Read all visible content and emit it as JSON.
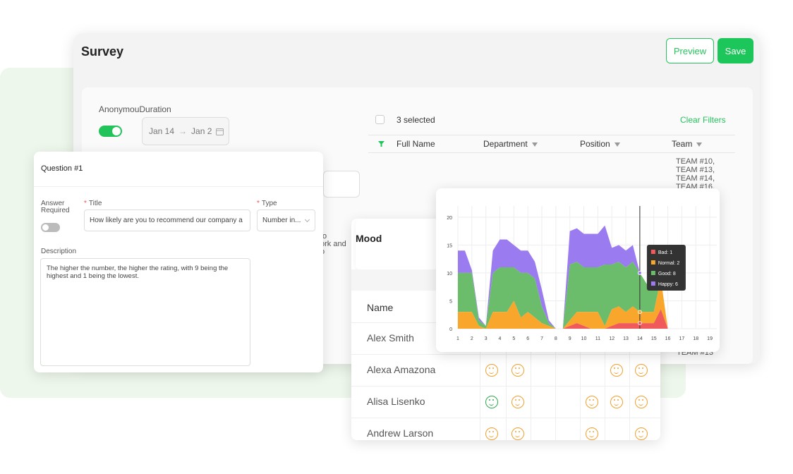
{
  "survey": {
    "title": "Survey",
    "preview_label": "Preview",
    "save_label": "Save",
    "anonymous_label": "AnonymouDuration",
    "date_start": "Jan 14",
    "date_end": "Jan 2",
    "bg_text": [
      "to",
      "ork and",
      "o"
    ]
  },
  "table": {
    "selected_text": "3 selected",
    "clear_filters": "Clear Filters",
    "headers": [
      "Full Name",
      "Department",
      "Position",
      "Team"
    ],
    "team_cells": [
      "TEAM #10,",
      "TEAM #13,",
      "TEAM #14,",
      "TEAM #16,"
    ],
    "team_bottom": "TEAM #13"
  },
  "question": {
    "title": "Question #1",
    "answer_required_label": [
      "Answer",
      "Required"
    ],
    "title_label": "Title",
    "type_label": "Type",
    "title_value": "How likely are you to recommend our company a",
    "type_value": "Number in...",
    "description_label": "Description",
    "description_value": "The higher the number, the higher the rating, with 9 being the highest and 1 being the lowest."
  },
  "mood": {
    "title": "Mood",
    "name_header": "Name",
    "rows": [
      {
        "name": "Alex Smith",
        "faces": []
      },
      {
        "name": "Alexa Amazona",
        "faces": [
          "neutral",
          "neutral",
          "",
          "",
          "",
          "neutral",
          "neutral"
        ]
      },
      {
        "name": "Alisa Lisenko",
        "faces": [
          "happy",
          "neutral",
          "",
          "",
          "neutral",
          "neutral",
          "neutral"
        ]
      },
      {
        "name": "Andrew Larson",
        "faces": [
          "neutral",
          "neutral",
          "",
          "",
          "neutral",
          "",
          "neutral"
        ]
      }
    ]
  },
  "chart_data": {
    "type": "area",
    "stacked": true,
    "x": [
      1,
      1.5,
      2,
      2.5,
      3,
      3.5,
      4,
      4.5,
      5,
      5.5,
      6,
      6.5,
      7,
      7.5,
      8,
      8.5,
      9,
      9.5,
      10,
      10.5,
      11,
      11.5,
      12,
      12.5,
      13,
      13.5,
      14,
      14.5,
      15,
      15.5,
      16,
      16.5,
      17,
      17.5,
      18,
      18.5,
      19,
      19.5
    ],
    "ylim": [
      0,
      22
    ],
    "yticks": [
      0,
      5,
      10,
      15,
      20
    ],
    "xticks": [
      1,
      2,
      3,
      4,
      5,
      6,
      7,
      8,
      9,
      10,
      11,
      12,
      13,
      14,
      15,
      16,
      17,
      18,
      19
    ],
    "series": [
      {
        "name": "Bad",
        "color": "#f05a5a",
        "values": [
          0,
          0,
          0,
          0,
          0,
          0,
          0,
          0,
          0,
          0,
          0,
          0,
          0,
          0,
          0,
          0,
          0.5,
          1,
          0.5,
          0,
          0,
          0,
          0.5,
          1,
          1,
          1,
          1,
          1,
          1,
          3.5,
          0,
          0,
          0,
          0,
          0,
          0,
          0,
          0
        ]
      },
      {
        "name": "Normal",
        "color": "#f8a62c",
        "values": [
          3,
          3,
          3,
          0.5,
          0,
          3,
          3,
          3,
          5,
          2,
          3,
          2,
          1,
          0.5,
          0,
          0,
          1,
          2,
          2.5,
          3,
          3,
          0.5,
          3,
          3,
          2,
          3,
          2,
          2,
          2,
          5.5,
          0,
          0,
          0,
          0,
          0,
          0,
          0,
          0
        ]
      },
      {
        "name": "Good",
        "color": "#6cbd6b",
        "values": [
          7,
          7,
          7,
          1,
          0.5,
          7,
          8,
          8,
          6,
          8,
          7,
          7,
          3,
          0.5,
          0,
          0,
          10,
          9,
          8,
          8,
          8,
          11,
          8,
          8,
          8,
          8,
          7,
          5,
          5,
          0,
          0,
          0,
          0,
          0,
          0,
          0,
          0,
          0
        ]
      },
      {
        "name": "Happy",
        "color": "#9b7bf0",
        "values": [
          4,
          4,
          0.5,
          0.5,
          0,
          4,
          5,
          5,
          4,
          4,
          4,
          3,
          3,
          0.5,
          0,
          0,
          6,
          6,
          6,
          6,
          6,
          7,
          3,
          3,
          3,
          3,
          0,
          0,
          0,
          0,
          0,
          0,
          0,
          0,
          0,
          0,
          0,
          0
        ]
      }
    ],
    "tooltip": {
      "x": 14,
      "items": [
        "Bad: 1",
        "Normal: 2",
        "Good: 8",
        "Happy: 6"
      ]
    }
  }
}
